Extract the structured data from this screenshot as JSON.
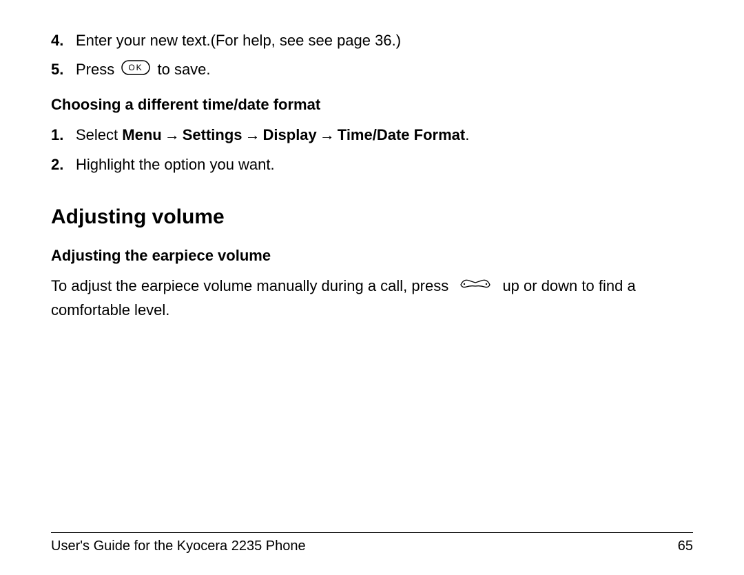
{
  "steps_top": [
    {
      "num": "4.",
      "text": "Enter your new text.(For help, see see page 36.)"
    },
    {
      "num": "5.",
      "prefix": "Press ",
      "suffix": " to save."
    }
  ],
  "subheading1": "Choosing a different time/date format",
  "steps_mid": [
    {
      "num": "1.",
      "prefix": "Select ",
      "bold_parts": [
        "Menu",
        "Settings",
        "Display",
        "Time/Date Format"
      ],
      "arrow": "→",
      "suffix": "."
    },
    {
      "num": "2.",
      "text": "Highlight the option you want."
    }
  ],
  "heading": "Adjusting volume",
  "subheading2": "Adjusting the earpiece volume",
  "paragraph_parts": {
    "before": "To adjust the earpiece volume manually during a call, press ",
    "after": " up or down to find a comfortable level."
  },
  "footer": {
    "left": "User's Guide for the Kyocera 2235 Phone",
    "right": "65"
  }
}
